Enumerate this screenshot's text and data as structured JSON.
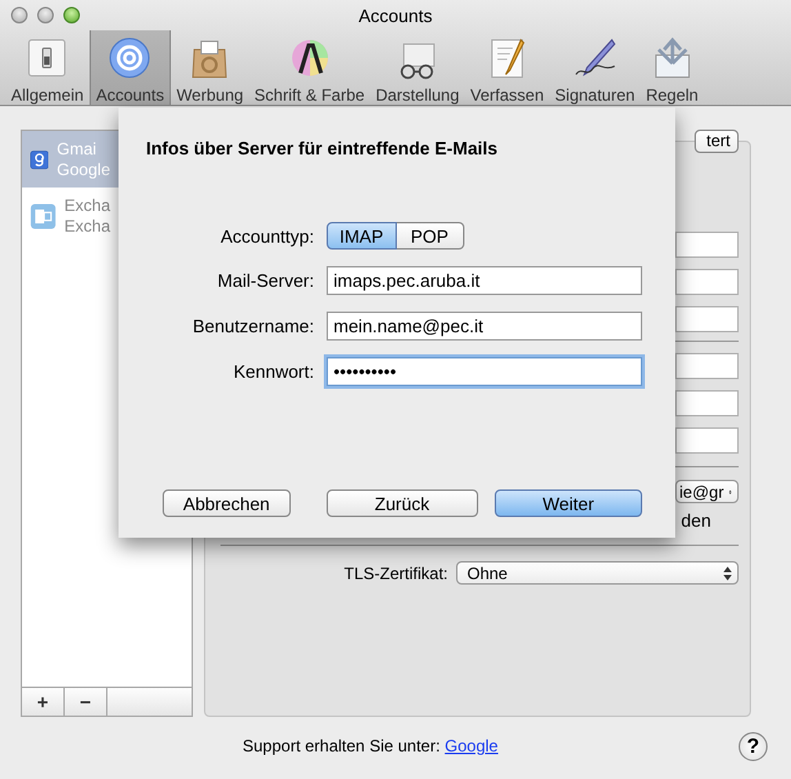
{
  "window": {
    "title": "Accounts"
  },
  "toolbar": {
    "items": [
      {
        "label": "Allgemein",
        "selected": false
      },
      {
        "label": "Accounts",
        "selected": true
      },
      {
        "label": "Werbung",
        "selected": false
      },
      {
        "label": "Schrift & Farbe",
        "selected": false
      },
      {
        "label": "Darstellung",
        "selected": false
      },
      {
        "label": "Verfassen",
        "selected": false
      },
      {
        "label": "Signaturen",
        "selected": false
      },
      {
        "label": "Regeln",
        "selected": false
      }
    ]
  },
  "sidebar": {
    "accounts": [
      {
        "name": "Gmai",
        "subtitle": "Google",
        "kind": "google",
        "selected": true,
        "disabled": false
      },
      {
        "name": "Excha",
        "subtitle": "Excha",
        "kind": "exchange",
        "selected": false,
        "disabled": true
      }
    ],
    "buttons": [
      "+",
      "−"
    ]
  },
  "account_panel": {
    "tab_button": "tert",
    "server_popup": "ie@gr",
    "checkbox_label": "den",
    "tls_label": "TLS-Zertifikat:",
    "tls_value": "Ohne"
  },
  "sheet": {
    "title": "Infos über Server für eintreffende E-Mails",
    "account_type": {
      "label": "Accounttyp:",
      "options": [
        {
          "label": "IMAP",
          "selected": true
        },
        {
          "label": "POP",
          "selected": false
        }
      ]
    },
    "fields": [
      {
        "label": "Mail-Server:",
        "value": "imaps.pec.aruba.it",
        "focused": false
      },
      {
        "label": "Benutzername:",
        "value": "mein.name@pec.it",
        "focused": false
      },
      {
        "label": "Kennwort:",
        "value": "••••••••••",
        "focused": true
      }
    ],
    "buttons": [
      {
        "label": "Abbrechen",
        "default": false
      },
      {
        "label": "Zurück",
        "default": false
      },
      {
        "label": "Weiter",
        "default": true
      }
    ]
  },
  "footer": {
    "text": "Support erhalten Sie unter:",
    "link": "Google",
    "help": "?"
  }
}
